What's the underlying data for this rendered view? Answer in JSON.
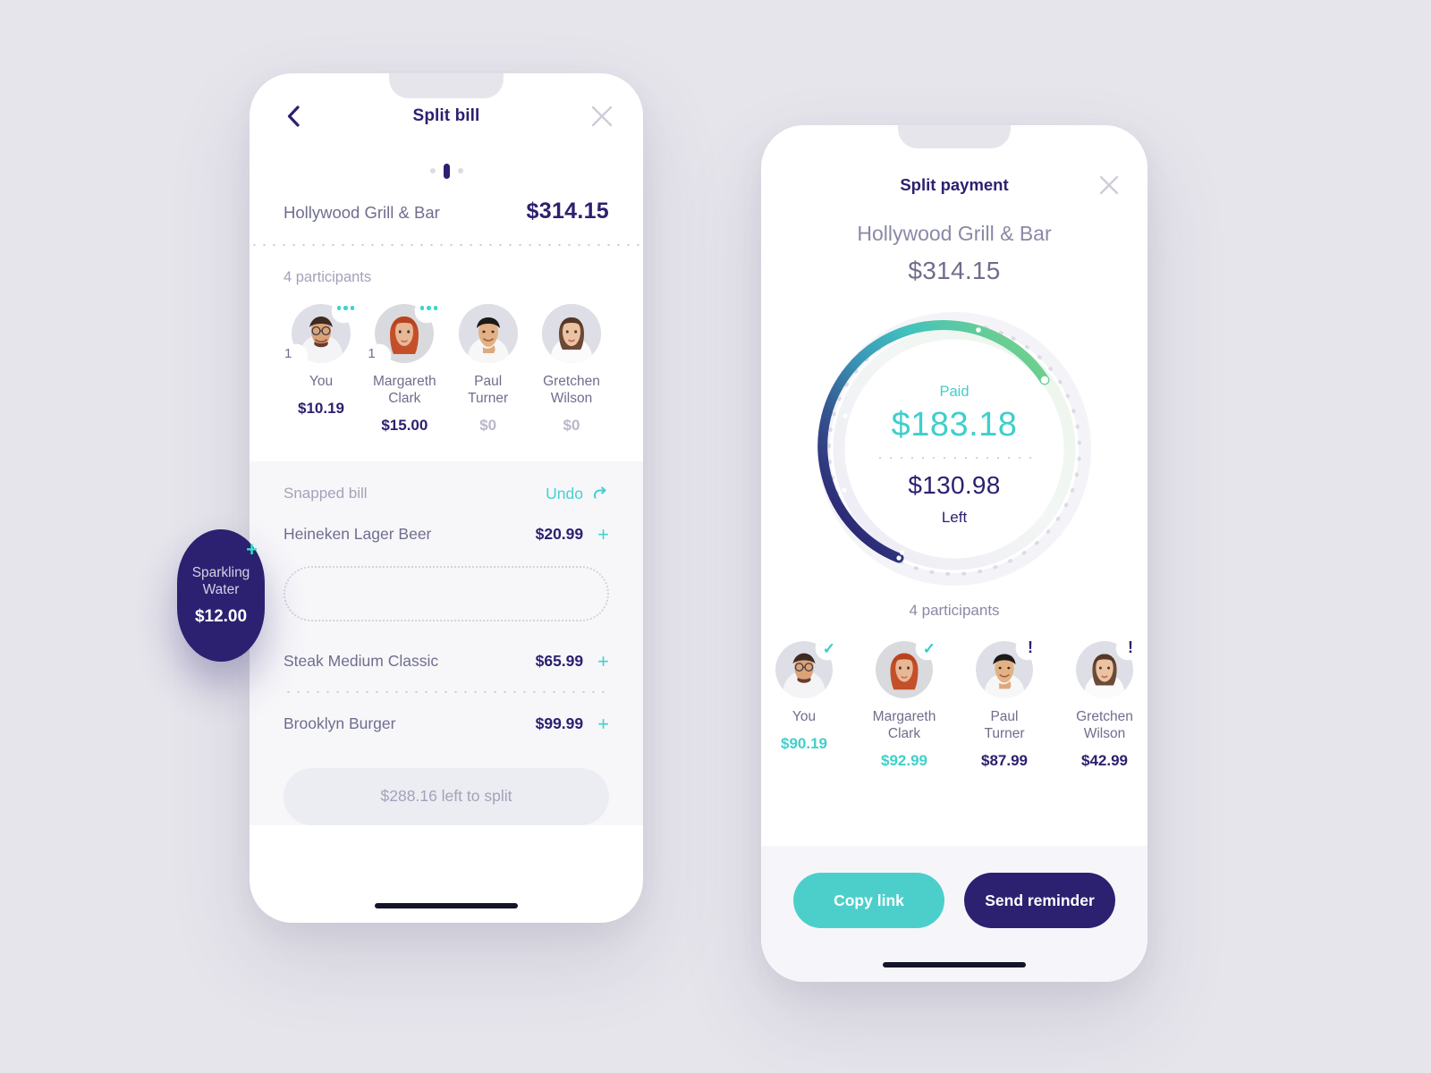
{
  "theme": {
    "background": "#e6e5ec",
    "ink": "#2b2170",
    "muted": "#6f6e8e",
    "faint": "#a3a2b8",
    "teal": "#3fd0cc",
    "green": "#72d08a",
    "navy": "#2b2170"
  },
  "split_bill": {
    "header": {
      "title": "Split bill",
      "back_icon": "chevron-left-icon",
      "close_icon": "close-icon"
    },
    "pager": {
      "pages": 3,
      "active_index": 1
    },
    "bill": {
      "merchant": "Hollywood Grill & Bar",
      "total": "$314.15"
    },
    "participants_label": "4 participants",
    "participants": [
      {
        "name": "You",
        "amount": "$10.19",
        "count": "1",
        "state": "active",
        "amount_style": "normal"
      },
      {
        "name": "Margareth\nClark",
        "amount": "$15.00",
        "count": "1",
        "state": "active",
        "amount_style": "normal"
      },
      {
        "name": "Paul\nTurner",
        "amount": "$0",
        "count": "",
        "state": "idle",
        "amount_style": "muted"
      },
      {
        "name": "Gretchen\nWilson",
        "amount": "$0",
        "count": "",
        "state": "idle",
        "amount_style": "muted"
      }
    ],
    "snapped": {
      "title": "Snapped bill",
      "undo_label": "Undo",
      "undo_icon": "redo-arrow-icon",
      "items": [
        {
          "name": "Heineken Lager Beer",
          "price": "$20.99",
          "add_icon": "plus-icon"
        },
        {
          "name": "Steak Medium Classic",
          "price": "$65.99",
          "add_icon": "plus-icon"
        },
        {
          "name": "Brooklyn Burger",
          "price": "$99.99",
          "add_icon": "plus-icon"
        }
      ],
      "drop_slot_label": ""
    },
    "cta": "$288.16 left to split"
  },
  "drag_bubble": {
    "name": "Sparkling Water",
    "amount": "$12.00",
    "add_icon": "plus-icon"
  },
  "split_payment": {
    "header": {
      "title": "Split payment",
      "close_icon": "close-icon"
    },
    "merchant": "Hollywood Grill & Bar",
    "total": "$314.15",
    "gauge": {
      "paid_label": "Paid",
      "paid_value": "$183.18",
      "left_value": "$130.98",
      "left_label": "Left",
      "progress_percent": 58,
      "gradient_start": "#2b2170",
      "gradient_mid": "#3fb4c4",
      "gradient_end": "#72d08a"
    },
    "participants_label": "4 participants",
    "participants": [
      {
        "name": "You",
        "amount": "$90.19",
        "status": "paid",
        "status_icon": "check-icon"
      },
      {
        "name": "Margareth\nClark",
        "amount": "$92.99",
        "status": "paid",
        "status_icon": "check-icon"
      },
      {
        "name": "Paul\nTurner",
        "amount": "$87.99",
        "status": "pending",
        "status_icon": "exclamation-icon"
      },
      {
        "name": "Gretchen\nWilson",
        "amount": "$42.99",
        "status": "pending",
        "status_icon": "exclamation-icon"
      }
    ],
    "actions": {
      "copy_link": "Copy link",
      "send_reminder": "Send reminder"
    }
  }
}
